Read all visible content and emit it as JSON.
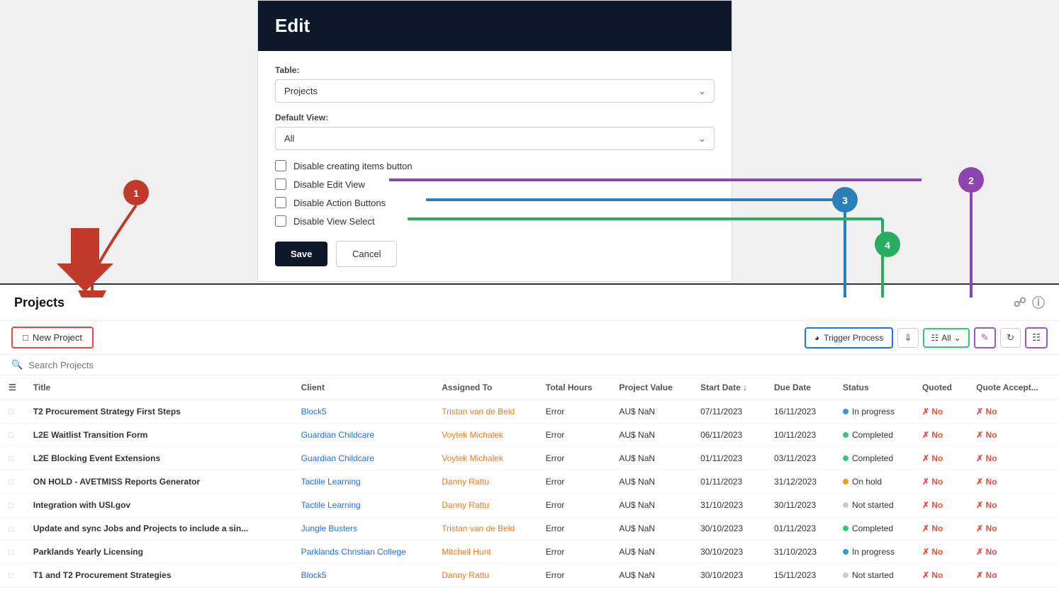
{
  "edit_panel": {
    "title": "Edit",
    "table_label": "Table:",
    "table_value": "Projects",
    "default_view_label": "Default View:",
    "default_view_value": "All",
    "checkboxes": [
      {
        "id": "cb1",
        "label": "Disable creating items button",
        "checked": false
      },
      {
        "id": "cb2",
        "label": "Disable Edit View",
        "checked": false
      },
      {
        "id": "cb3",
        "label": "Disable Action Buttons",
        "checked": false
      },
      {
        "id": "cb4",
        "label": "Disable View Select",
        "checked": false
      }
    ],
    "save_label": "Save",
    "cancel_label": "Cancel"
  },
  "projects_section": {
    "title": "Projects",
    "new_project_label": "New Project",
    "trigger_process_label": "Trigger Process",
    "filter_label": "All",
    "search_placeholder": "Search Projects",
    "columns": [
      "",
      "Title",
      "Client",
      "Assigned To",
      "Total Hours",
      "Project Value",
      "Start Date ↓",
      "Due Date",
      "Status",
      "Quoted",
      "Quote Accept..."
    ],
    "rows": [
      {
        "title": "T2 Procurement Strategy First Steps",
        "client": "Block5",
        "assigned": "Tristan van de Beld",
        "hours": "Error",
        "value": "AU$ NaN",
        "start": "07/11/2023",
        "due": "16/11/2023",
        "status": "In progress",
        "status_type": "inprogress",
        "quoted": "No",
        "quote_accept": "No"
      },
      {
        "title": "L2E Waitlist Transition Form",
        "client": "Guardian Childcare",
        "assigned": "Voytek Michalek",
        "hours": "Error",
        "value": "AU$ NaN",
        "start": "06/11/2023",
        "due": "10/11/2023",
        "status": "Completed",
        "status_type": "completed",
        "quoted": "No",
        "quote_accept": "No"
      },
      {
        "title": "L2E Blocking Event Extensions",
        "client": "Guardian Childcare",
        "assigned": "Voytek Michalek",
        "hours": "Error",
        "value": "AU$ NaN",
        "start": "01/11/2023",
        "due": "03/11/2023",
        "status": "Completed",
        "status_type": "completed",
        "quoted": "No",
        "quote_accept": "No"
      },
      {
        "title": "ON HOLD - AVETMISS Reports Generator",
        "client": "Tactile Learning",
        "assigned": "Danny Rattu",
        "hours": "Error",
        "value": "AU$ NaN",
        "start": "01/11/2023",
        "due": "31/12/2023",
        "status": "On hold",
        "status_type": "onhold",
        "quoted": "No",
        "quote_accept": "No"
      },
      {
        "title": "Integration with USI.gov",
        "client": "Tactile Learning",
        "assigned": "Danny Rattu",
        "hours": "Error",
        "value": "AU$ NaN",
        "start": "31/10/2023",
        "due": "30/11/2023",
        "status": "Not started",
        "status_type": "notstarted",
        "quoted": "No",
        "quote_accept": "No"
      },
      {
        "title": "Update and sync Jobs and Projects to include a sin...",
        "client": "Jungle Busters",
        "assigned": "Tristan van de Beld",
        "hours": "Error",
        "value": "AU$ NaN",
        "start": "30/10/2023",
        "due": "01/11/2023",
        "status": "Completed",
        "status_type": "completed",
        "quoted": "No",
        "quote_accept": "No"
      },
      {
        "title": "Parklands Yearly Licensing",
        "client": "Parklands Christian College",
        "assigned": "Mitchell Hunt",
        "hours": "Error",
        "value": "AU$ NaN",
        "start": "30/10/2023",
        "due": "31/10/2023",
        "status": "In progress",
        "status_type": "inprogress",
        "quoted": "No",
        "quote_accept": "No"
      },
      {
        "title": "T1 and T2 Procurement Strategies",
        "client": "Block5",
        "assigned": "Danny Rattu",
        "hours": "Error",
        "value": "AU$ NaN",
        "start": "30/10/2023",
        "due": "15/11/2023",
        "status": "Not started",
        "status_type": "notstarted",
        "quoted": "No",
        "quote_accept": "No"
      }
    ]
  },
  "badges": {
    "b1_num": "1",
    "b2_num": "2",
    "b3_num": "3",
    "b4_num": "4"
  },
  "colors": {
    "red_arrow": "#c0392b",
    "purple_line": "#8e44ad",
    "blue_line": "#2980b9",
    "green_line": "#27ae60",
    "accent_blue": "#1a73e8"
  }
}
